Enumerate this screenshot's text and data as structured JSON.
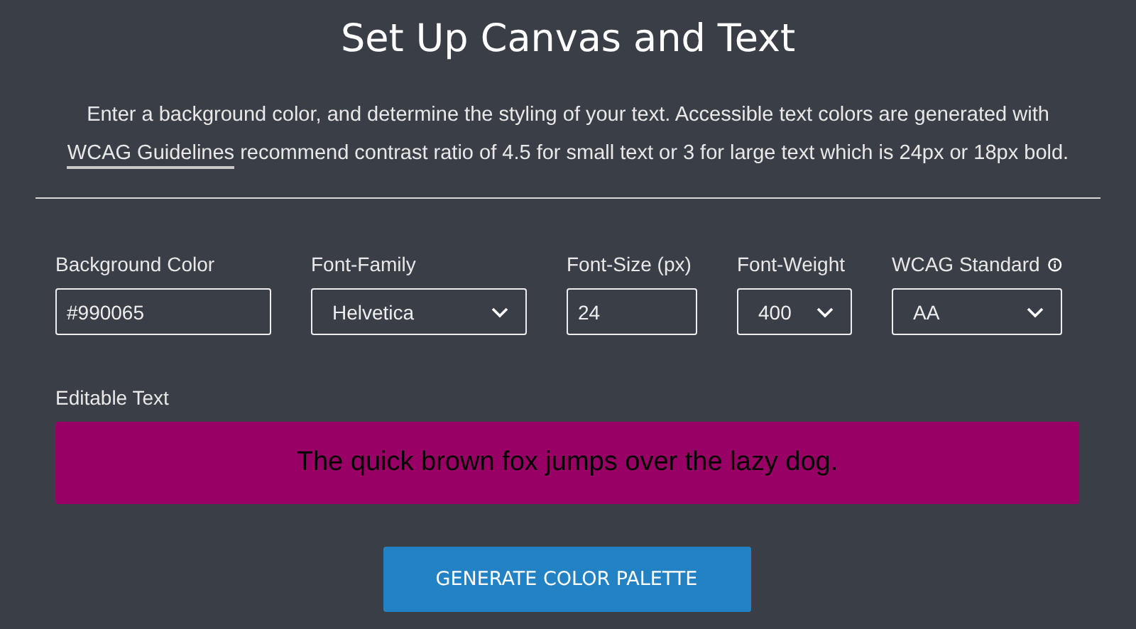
{
  "title": "Set Up Canvas and Text",
  "intro": {
    "text": "Enter a background color, and determine the styling of your text. Accessible text colors are generated with",
    "link": "WCAG Guidelines",
    "rest": "recommend contrast ratio of 4.5 for small text or 3 for large text which is 24px or 18px bold."
  },
  "fields": [
    {
      "label": "Background Color",
      "kind": "input",
      "value": "#990065"
    },
    {
      "label": "Font-Family",
      "kind": "select",
      "value": "Helvetica"
    },
    {
      "label": "Font-Size (px)",
      "kind": "input",
      "value": "24"
    },
    {
      "label": "Font-Weight",
      "kind": "select",
      "value": "400"
    },
    {
      "label": "WCAG Standard",
      "kind": "select",
      "value": "AA",
      "info": true
    }
  ],
  "preview": {
    "label": "Editable Text",
    "text": "The quick brown fox jumps over the lazy dog."
  },
  "button": "GENERATE COLOR PALETTE"
}
